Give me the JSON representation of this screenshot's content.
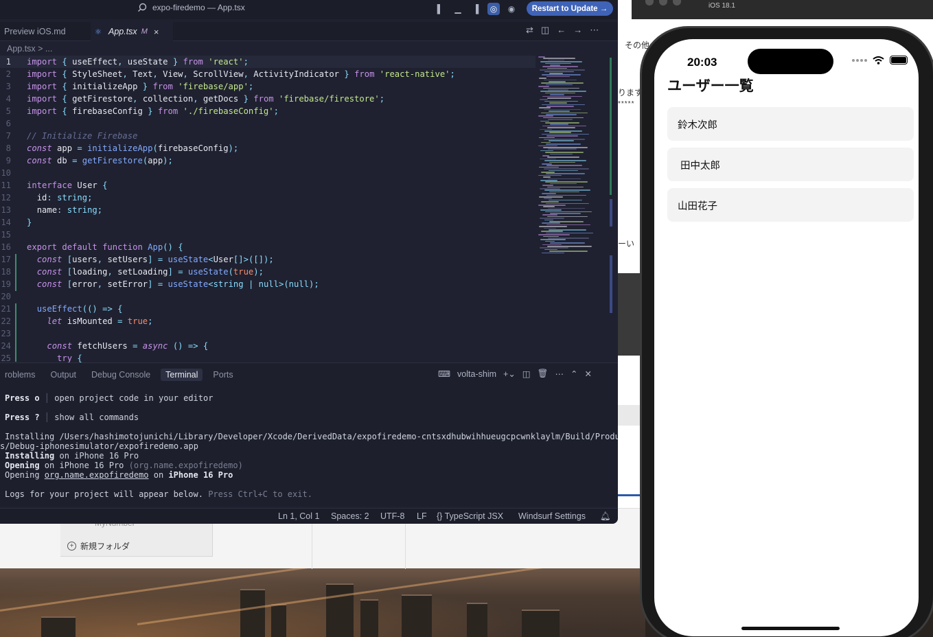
{
  "vscode": {
    "window_title": "expo-firedemo — App.tsx",
    "update_button": "Restart to Update →",
    "tabs": [
      {
        "label": "Preview iOS.md",
        "modified": "",
        "close": ""
      },
      {
        "label": "App.tsx",
        "modified": "M",
        "close": "×"
      }
    ],
    "breadcrumb": "App.tsx  >  ...",
    "code_lines": [
      "import { useEffect, useState } from 'react';",
      "import { StyleSheet, Text, View, ScrollView, ActivityIndicator } from 'react-native';",
      "import { initializeApp } from 'firebase/app';",
      "import { getFirestore, collection, getDocs } from 'firebase/firestore';",
      "import { firebaseConfig } from './firebaseConfig';",
      "",
      "// Initialize Firebase",
      "const app = initializeApp(firebaseConfig);",
      "const db = getFirestore(app);",
      "",
      "interface User {",
      "  id: string;",
      "  name: string;",
      "}",
      "",
      "export default function App() {",
      "  const [users, setUsers] = useState<User[]>([]);",
      "  const [loading, setLoading] = useState(true);",
      "  const [error, setError] = useState<string | null>(null);",
      "",
      "  useEffect(() => {",
      "    let isMounted = true;",
      "",
      "    const fetchUsers = async () => {",
      "      try {"
    ],
    "panel_tabs": [
      "roblems",
      "Output",
      "Debug Console",
      "Terminal",
      "Ports"
    ],
    "active_panel_tab": "Terminal",
    "terminal_name": "volta-shim",
    "terminal": {
      "press_o_key": "Press o",
      "press_o_text": "open project code in your editor",
      "press_q_key": "Press ?",
      "press_q_text": "show all commands",
      "installing_path_1": "Installing /Users/hashimotojunichi/Library/Developer/Xcode/DerivedData/expofiredemo-cntsxdhubwihhueugcpcwnklaylm/Build/Produc",
      "installing_path_2": "s/Debug-iphonesimulator/expofiredemo.app",
      "installing_word": "Installing",
      "installing_on": " on iPhone 16 Pro",
      "opening_word": "Opening",
      "opening_on": " on iPhone 16 Pro ",
      "opening_bundle_dim": "(org.name.expofiredemo)",
      "opening2_word": "Opening ",
      "opening2_link": "org.name.expofiredemo",
      "opening2_on": " on ",
      "opening2_device": "iPhone 16 Pro",
      "logs_text": "Logs for your project will appear below.",
      "logs_hint": " Press Ctrl+C to exit."
    },
    "status": {
      "position": "Ln 1, Col 1",
      "spaces": "Spaces: 2",
      "encoding": "UTF-8",
      "eol": "LF",
      "language": "{} TypeScript JSX",
      "settings": "Windsurf Settings"
    }
  },
  "background": {
    "ios_version": "iOS 18.1",
    "sonota": "その他",
    "masu": "ります",
    "stars": "*****",
    "ii": "ーい",
    "finder_item": "MyNumber",
    "finder_new_folder": "新規フォルダ"
  },
  "phone": {
    "time": "20:03",
    "title": "ユーザー一覧",
    "users": [
      "鈴木次郎",
      " 田中太郎",
      "山田花子"
    ]
  },
  "colors": {
    "editor_bg": "#1f2130",
    "accent_button": "#3f63b7",
    "keyword": "#c792ea",
    "string": "#c3e88d",
    "function": "#82aaff"
  }
}
